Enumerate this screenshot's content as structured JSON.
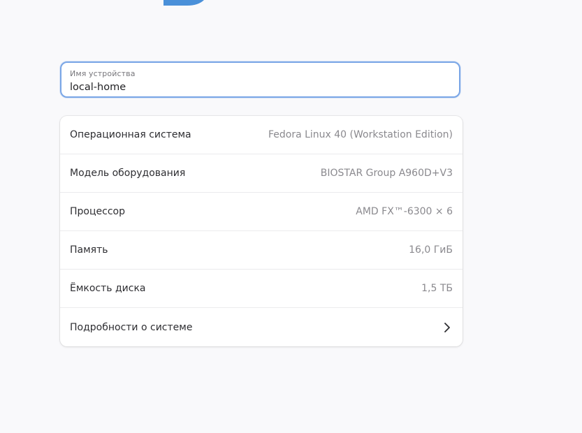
{
  "colors": {
    "background": "#f9f9fb",
    "card": "#ffffff",
    "focus_border": "#7aa6e6",
    "logo_blue": "#4a90d9",
    "secondary_text": "#8a898e"
  },
  "device_name": {
    "label": "Имя устройства",
    "value": "local-home"
  },
  "info_rows": [
    {
      "title": "Операционная система",
      "value": "Fedora Linux 40 (Workstation Edition)"
    },
    {
      "title": "Модель оборудования",
      "value": "BIOSTAR Group A960D+V3"
    },
    {
      "title": "Процессор",
      "value": "AMD FX™-6300 × 6"
    },
    {
      "title": "Память",
      "value": "16,0 ГиБ"
    },
    {
      "title": "Ёмкость диска",
      "value": "1,5 ТБ"
    }
  ],
  "details_row": {
    "title": "Подробности о системе",
    "icon": "chevron-right-icon"
  }
}
